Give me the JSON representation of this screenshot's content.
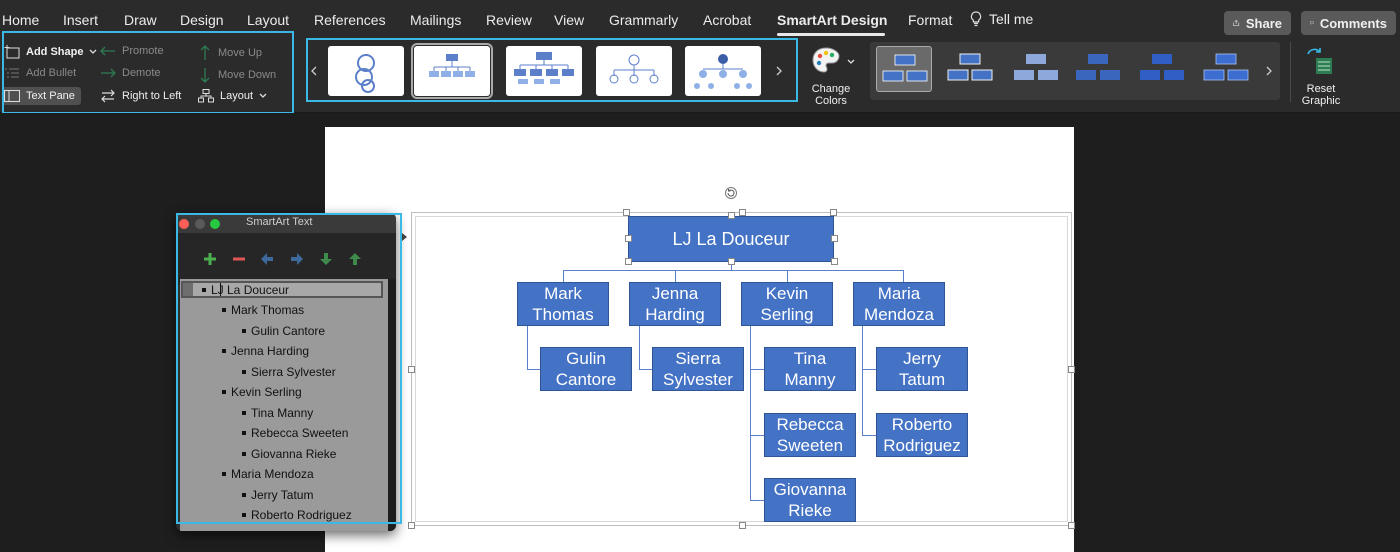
{
  "tabs": [
    "Home",
    "Insert",
    "Draw",
    "Design",
    "Layout",
    "References",
    "Mailings",
    "Review",
    "View",
    "Grammarly",
    "Acrobat",
    "SmartArt Design",
    "Format"
  ],
  "tell_me": "Tell me",
  "share_label": "Share",
  "comments_label": "Comments",
  "ribbon": {
    "add_shape": "Add Shape",
    "add_bullet": "Add Bullet",
    "text_pane": "Text Pane",
    "promote": "Promote",
    "demote": "Demote",
    "right_to_left": "Right to Left",
    "move_up": "Move Up",
    "move_down": "Move Down",
    "layout": "Layout",
    "change_colors": "Change\nColors",
    "reset_graphic": "Reset\nGraphic"
  },
  "smartart": {
    "root": "LJ La Douceur",
    "managers": [
      "Mark\nThomas",
      "Jenna\nHarding",
      "Kevin\nSerling",
      "Maria\nMendoza"
    ],
    "reports": {
      "mark": [
        "Gulin\nCantore"
      ],
      "jenna": [
        "Sierra\nSylvester"
      ],
      "kevin": [
        "Tina\nManny",
        "Rebecca\nSweeten",
        "Giovanna\nRieke"
      ],
      "maria": [
        "Jerry\nTatum",
        "Roberto\nRodriguez"
      ]
    }
  },
  "text_pane": {
    "title": "SmartArt Text",
    "items": [
      {
        "level": 1,
        "text": "LJ La Douceur"
      },
      {
        "level": 2,
        "text": "Mark Thomas"
      },
      {
        "level": 3,
        "text": "Gulin Cantore"
      },
      {
        "level": 2,
        "text": "Jenna Harding"
      },
      {
        "level": 3,
        "text": "Sierra Sylvester"
      },
      {
        "level": 2,
        "text": "Kevin Serling"
      },
      {
        "level": 3,
        "text": "Tina Manny"
      },
      {
        "level": 3,
        "text": "Rebecca Sweeten"
      },
      {
        "level": 3,
        "text": "Giovanna Rieke"
      },
      {
        "level": 2,
        "text": "Maria Mendoza"
      },
      {
        "level": 3,
        "text": "Jerry Tatum"
      },
      {
        "level": 3,
        "text": "Roberto Rodriguez"
      }
    ]
  },
  "colors": {
    "accent": "#3bb8e3",
    "box": "#4472c4"
  }
}
